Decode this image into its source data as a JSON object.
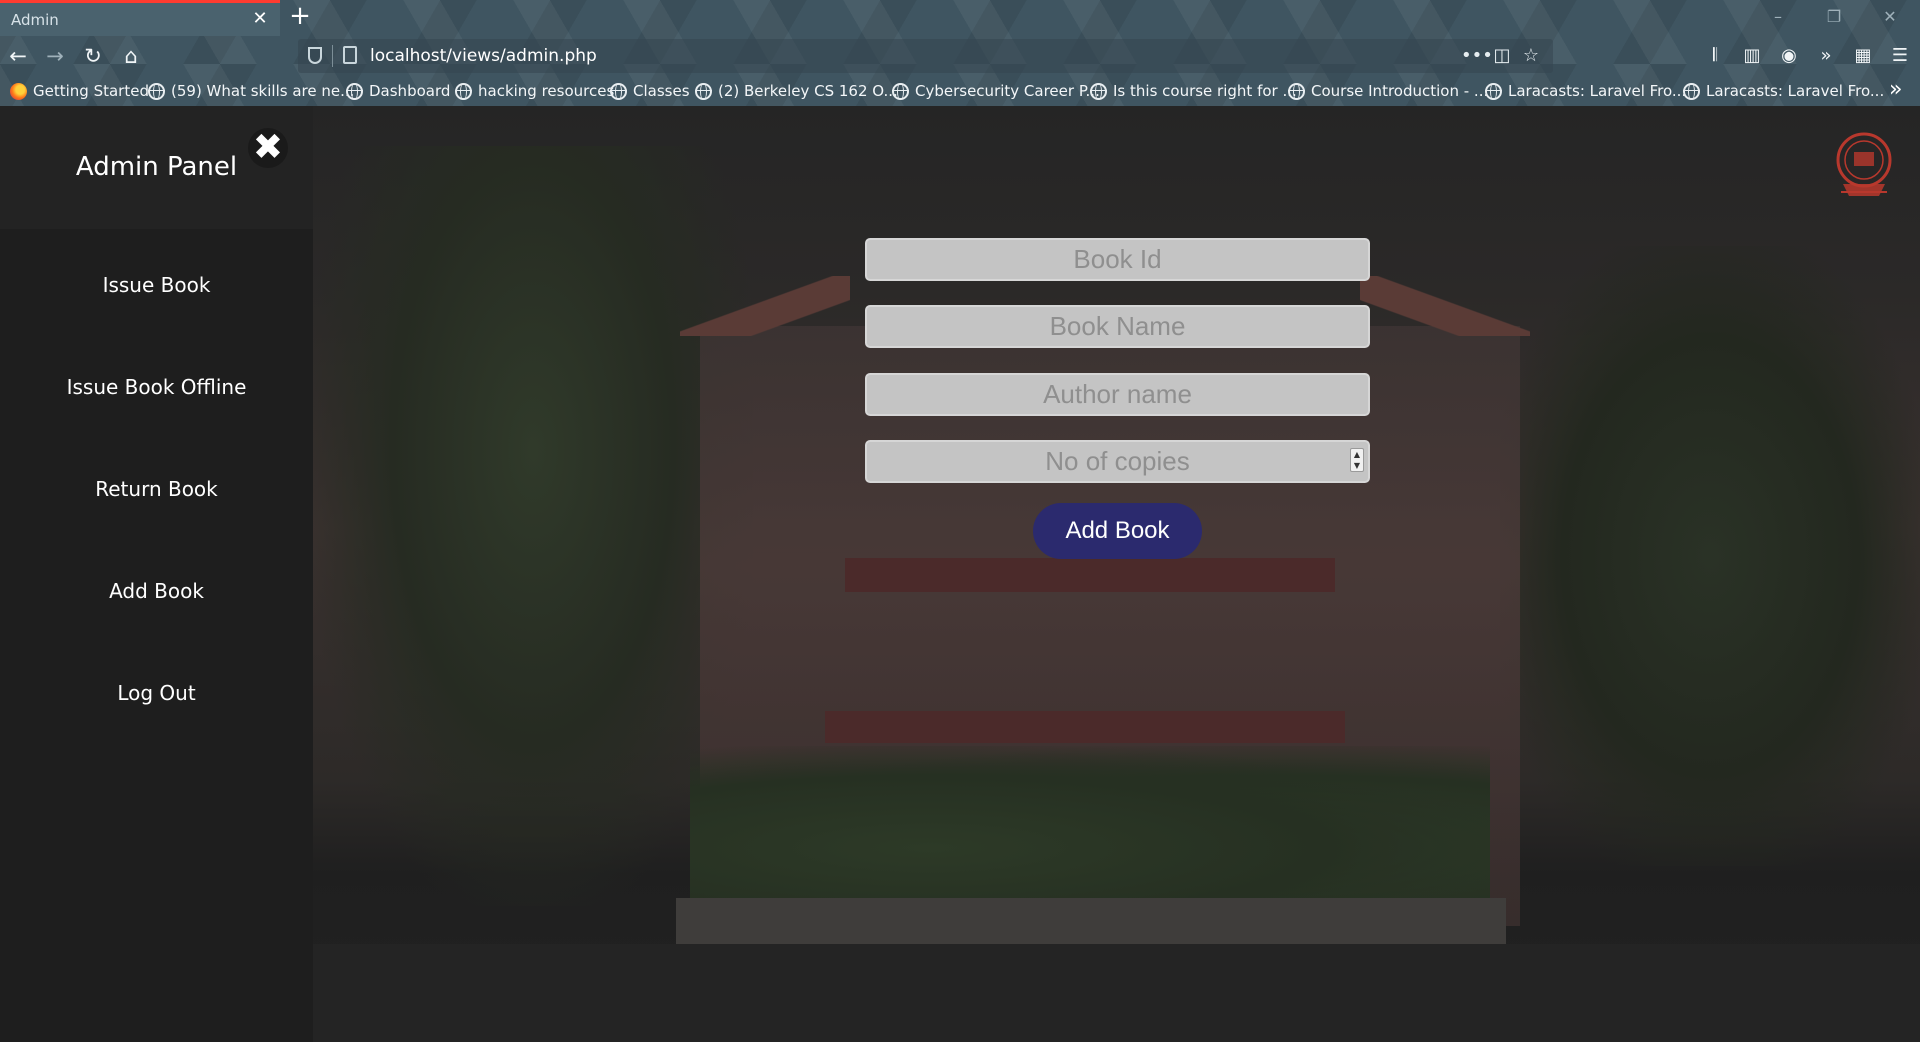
{
  "browser": {
    "tab_title": "Admin",
    "url": "localhost/views/admin.php",
    "bookmarks": [
      {
        "label": "Getting Started",
        "icon": "firefox-icon"
      },
      {
        "label": "(59) What skills are ne...",
        "icon": "globe-icon"
      },
      {
        "label": "Dashboard",
        "icon": "globe-icon"
      },
      {
        "label": "hacking resources",
        "icon": "globe-icon"
      },
      {
        "label": "Classes",
        "icon": "globe-icon"
      },
      {
        "label": "(2) Berkeley CS 162 O...",
        "icon": "globe-icon"
      },
      {
        "label": "Cybersecurity Career P...",
        "icon": "globe-icon"
      },
      {
        "label": "Is this course right for ...",
        "icon": "globe-icon"
      },
      {
        "label": "Course Introduction - ...",
        "icon": "globe-icon"
      },
      {
        "label": "Laracasts: Laravel Fro...",
        "icon": "globe-icon"
      },
      {
        "label": "Laracasts: Laravel Fro...",
        "icon": "globe-icon"
      }
    ]
  },
  "sidebar": {
    "title": "Admin Panel",
    "close_symbol": "✖",
    "items": [
      {
        "label": "Issue Book"
      },
      {
        "label": "Issue Book Offline"
      },
      {
        "label": "Return Book"
      },
      {
        "label": "Add Book"
      },
      {
        "label": "Log Out"
      }
    ]
  },
  "form": {
    "book_id_placeholder": "Book Id",
    "book_name_placeholder": "Book Name",
    "author_placeholder": "Author name",
    "copies_placeholder": "No of copies",
    "submit_label": "Add Book"
  },
  "colors": {
    "accent": "#2b2a6e",
    "sidebar": "#1e1e1e",
    "tab_indicator": "#ff3b30"
  }
}
